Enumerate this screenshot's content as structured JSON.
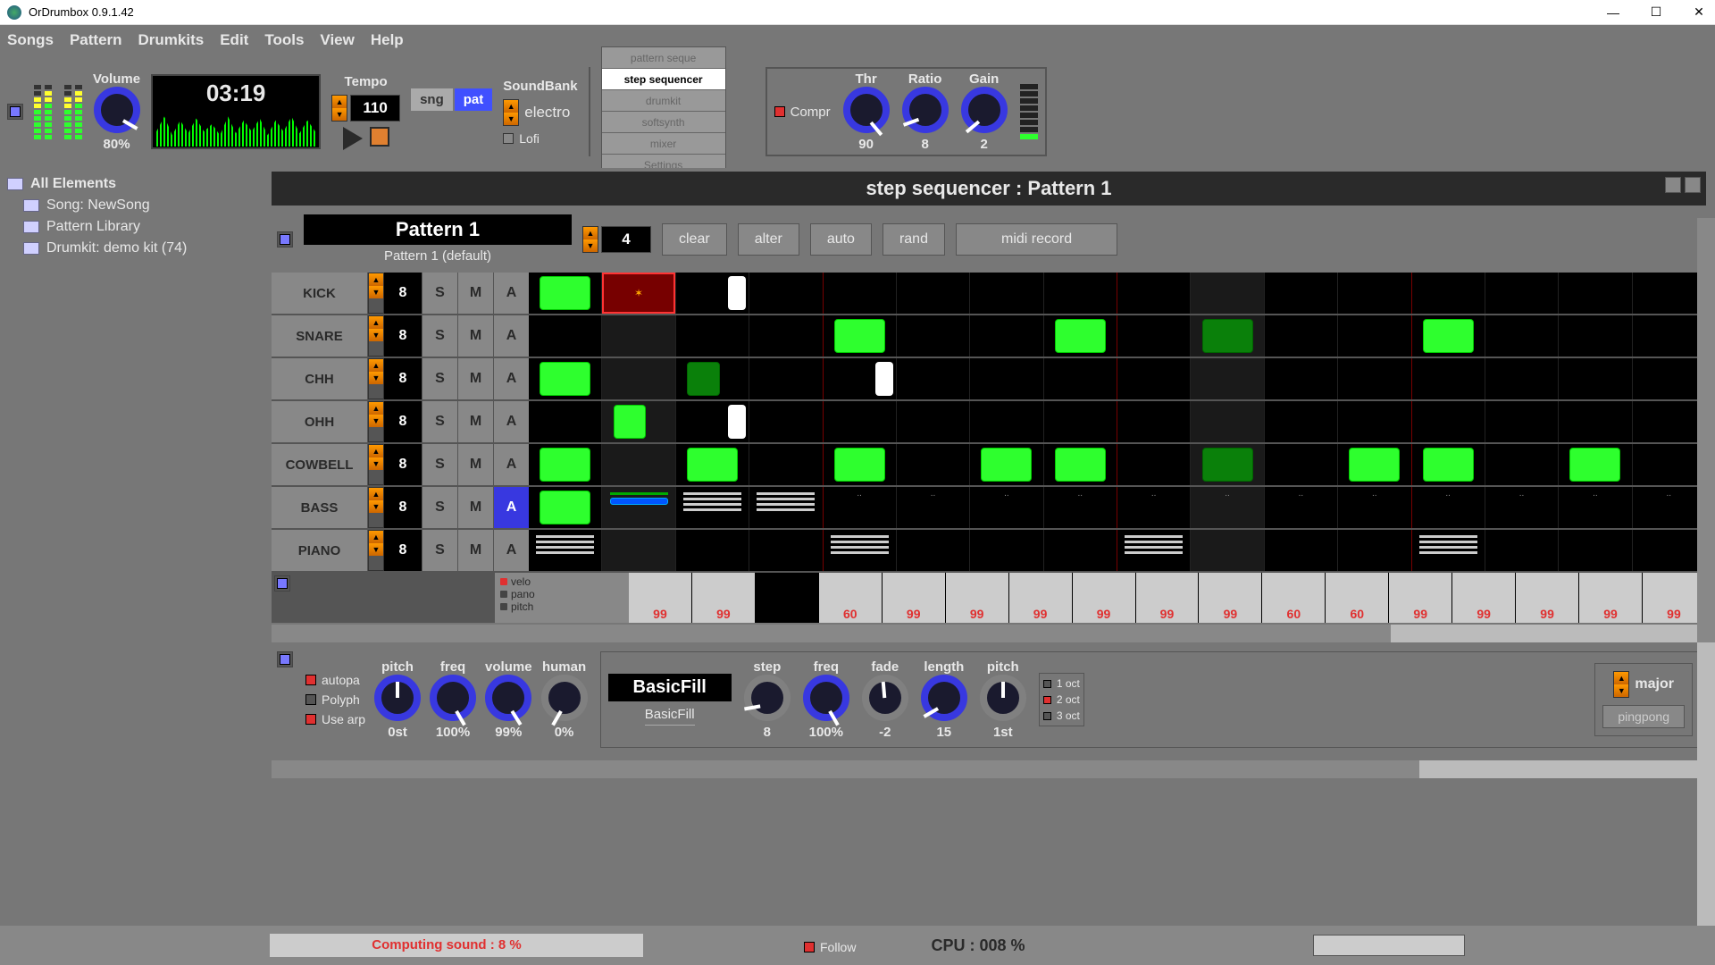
{
  "window": {
    "title": "OrDrumbox 0.9.1.42"
  },
  "menu": [
    "Songs",
    "Pattern",
    "Drumkits",
    "Edit",
    "Tools",
    "View",
    "Help"
  ],
  "toolbar": {
    "volume": {
      "label": "Volume",
      "value": "80%"
    },
    "time": "03:19",
    "tempo": {
      "label": "Tempo",
      "value": "110"
    },
    "sng": "sng",
    "pat": "pat",
    "soundbank": {
      "label": "SoundBank",
      "value": "electro",
      "lofi": "Lofi"
    },
    "tabs": [
      "pattern seque",
      "step sequencer",
      "drumkit",
      "softsynth",
      "mixer",
      "Settings"
    ],
    "compr": "Compr",
    "thr": {
      "label": "Thr",
      "value": "90"
    },
    "ratio": {
      "label": "Ratio",
      "value": "8"
    },
    "gain": {
      "label": "Gain",
      "value": "2"
    }
  },
  "tree": {
    "root": "All Elements",
    "items": [
      "Song: NewSong",
      "Pattern Library",
      "Drumkit: demo kit (74)"
    ]
  },
  "seq": {
    "title": "step sequencer : Pattern 1",
    "pattern_name": "Pattern 1",
    "pattern_sub": "Pattern 1 (default)",
    "beats": "4",
    "buttons": {
      "clear": "clear",
      "alter": "alter",
      "auto": "auto",
      "rand": "rand",
      "midi": "midi record"
    }
  },
  "tracks": [
    {
      "name": "KICK",
      "n": "8",
      "sma": [
        "S",
        "M",
        "A"
      ],
      "active_a": false
    },
    {
      "name": "SNARE",
      "n": "8",
      "sma": [
        "S",
        "M",
        "A"
      ],
      "active_a": false
    },
    {
      "name": "CHH",
      "n": "8",
      "sma": [
        "S",
        "M",
        "A"
      ],
      "active_a": false
    },
    {
      "name": "OHH",
      "n": "8",
      "sma": [
        "S",
        "M",
        "A"
      ],
      "active_a": false
    },
    {
      "name": "COWBELL",
      "n": "8",
      "sma": [
        "S",
        "M",
        "A"
      ],
      "active_a": false
    },
    {
      "name": "BASS",
      "n": "8",
      "sma": [
        "S",
        "M",
        "A"
      ],
      "active_a": true
    },
    {
      "name": "PIANO",
      "n": "8",
      "sma": [
        "S",
        "M",
        "A"
      ],
      "active_a": false
    }
  ],
  "velo": {
    "opts": [
      "velo",
      "pano",
      "pitch"
    ],
    "values": [
      "99",
      "99",
      "",
      "60",
      "99",
      "99",
      "99",
      "99",
      "99",
      "99",
      "60",
      "60",
      "99",
      "99",
      "99",
      "99",
      "99"
    ]
  },
  "inst": {
    "opts": [
      "autopa",
      "Polyph",
      "Use arp"
    ],
    "pitch": {
      "label": "pitch",
      "value": "0st"
    },
    "freq": {
      "label": "freq",
      "value": "100%"
    },
    "volume": {
      "label": "volume",
      "value": "99%"
    },
    "human": {
      "label": "human",
      "value": "0%"
    }
  },
  "fill": {
    "name": "BasicFill",
    "sub": "BasicFill",
    "step": {
      "label": "step",
      "value": "8"
    },
    "freq": {
      "label": "freq",
      "value": "100%"
    },
    "fade": {
      "label": "fade",
      "value": "-2"
    },
    "length": {
      "label": "length",
      "value": "15"
    },
    "pitch": {
      "label": "pitch",
      "value": "1st"
    },
    "follow": "Follow",
    "octs": [
      "1 oct",
      "2 oct",
      "3 oct"
    ]
  },
  "scale": {
    "value": "major",
    "button": "pingpong"
  },
  "status": {
    "progress": "Computing sound : 8 %",
    "cpu": "CPU : 008 %"
  }
}
